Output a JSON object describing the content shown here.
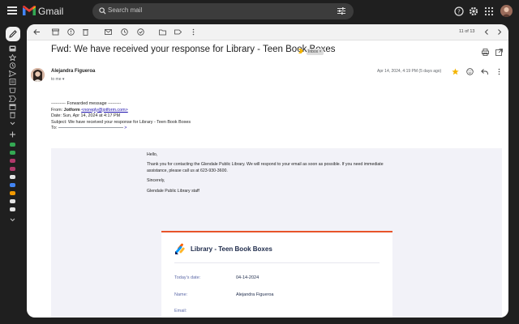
{
  "app": {
    "name": "Gmail"
  },
  "search": {
    "placeholder": "Search mail"
  },
  "toolbar": {
    "pager": "11 of 13"
  },
  "message": {
    "subject": "Fwd: We have received your response for Library - Teen Book Boxes",
    "label": "Inbox",
    "label_close": "×",
    "sender": "Alejandra Figueroa",
    "to": "to me",
    "date": "Apr 14, 2024, 4:19 PM (5 days ago)"
  },
  "forwarded": {
    "header": "---------- Forwarded message ---------",
    "from_prefix": "From:",
    "from_name": "Jotform",
    "from_email": "<noreply@jotform.com>",
    "date": "Date: Sun, Apr 14, 2024 at 4:17 PM",
    "subject": "Subject: We have received your response for Library - Teen Book Boxes",
    "to": "To:"
  },
  "email_body": {
    "greeting": "Hello,",
    "paragraph": "Thank you for contacting the Glendale Public Library. We will respond to your email as soon as possible. If you need immediate assistance, please call us at 623-930-3600.",
    "closing": "Sincerely,",
    "signature": "Glendale Public Library staff"
  },
  "form": {
    "title": "Library - Teen Book Boxes",
    "fields": [
      {
        "label": "Today's date:",
        "value": "04-14-2024"
      },
      {
        "label": "Name:",
        "value": "Alejandra Figueroa"
      },
      {
        "label": "Email:",
        "value": ""
      }
    ]
  },
  "colors": {
    "accent_orange": "#e8542a",
    "label_purple": "#5d6aa8",
    "star_yellow": "#f4b400"
  }
}
